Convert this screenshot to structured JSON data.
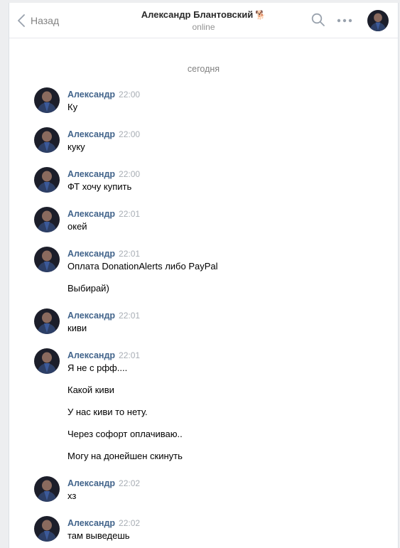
{
  "header": {
    "back_label": "Назад",
    "title": "Александр Блантовский",
    "title_emoji": "🐕",
    "status": "online"
  },
  "date_separator": "сегодня",
  "messages": [
    {
      "author": "Александр",
      "time": "22:00",
      "lines": [
        "Ку"
      ]
    },
    {
      "author": "Александр",
      "time": "22:00",
      "lines": [
        "куку"
      ]
    },
    {
      "author": "Александр",
      "time": "22:00",
      "lines": [
        "ФТ хочу купить"
      ]
    },
    {
      "author": "Александр",
      "time": "22:01",
      "lines": [
        "окей"
      ]
    },
    {
      "author": "Александр",
      "time": "22:01",
      "lines": [
        "Оплата DonationAlerts либо PayPal",
        "Выбирай)"
      ]
    },
    {
      "author": "Александр",
      "time": "22:01",
      "lines": [
        "киви"
      ]
    },
    {
      "author": "Александр",
      "time": "22:01",
      "lines": [
        "Я не с рфф....",
        "Какой киви",
        "У нас киви то нету.",
        "Через софорт оплачиваю..",
        "Могу на донейшен скинуть"
      ]
    },
    {
      "author": "Александр",
      "time": "22:02",
      "lines": [
        "хз"
      ]
    },
    {
      "author": "Александр",
      "time": "22:02",
      "lines": [
        "там выведешь"
      ]
    }
  ],
  "colors": {
    "author_link": "#42648b",
    "muted": "#828282",
    "page_bg": "#edeef0"
  },
  "icons": [
    "chevron-left-icon",
    "search-icon",
    "more-icon"
  ]
}
